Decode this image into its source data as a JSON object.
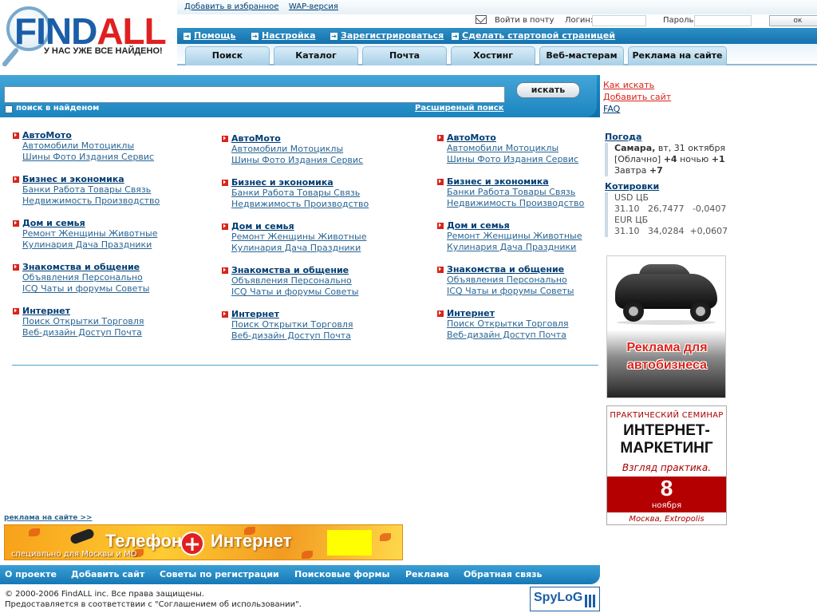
{
  "logo": {
    "name_part1": "FIND",
    "name_part2": "ALL",
    "slogan": "У НАС УЖЕ ВСЕ НАЙДЕНО!"
  },
  "topbar": {
    "favorites": "Добавить в избранное",
    "wap": "WAP-версия"
  },
  "login": {
    "mail_label": "Войти в почту",
    "login_label": "Логин:",
    "password_label": "Пароль:",
    "ok_label": "ок"
  },
  "links": {
    "help": "Помощь",
    "settings": "Настройка",
    "register": "Зарегистрироваться",
    "start_page_1": "Сделать",
    "start_page_2": "стартовой",
    "start_page_3": "страницей"
  },
  "tabs": [
    "Поиск",
    "Каталог",
    "Почта",
    "Хостинг",
    "Веб-мастерам",
    "Реклама на сайте"
  ],
  "search": {
    "button": "искать",
    "checkbox_label": "поиск в найденом",
    "advanced": "Расширеный поиск",
    "value": ""
  },
  "side_links": {
    "how": "Как искать",
    "add": "Добавить сайт",
    "faq": "FAQ"
  },
  "catalog": {
    "columns": [
      [
        {
          "title": "АвтоМото",
          "l1": "Автомобили Мотоциклы",
          "l2": "Шины Фото Издания Сервис"
        },
        {
          "title": "Бизнес и экономика",
          "l1": "Банки Работа Товары Связь",
          "l2": "Недвижимость Производство"
        },
        {
          "title": "Дом и семья",
          "l1": "Ремонт Женщины Животные",
          "l2": "Кулинария Дача Праздники"
        },
        {
          "title": "Знакомства и общение",
          "l1": "Объявления Персонально",
          "l2": "ICQ Чаты и форумы Советы"
        },
        {
          "title": "Интернет",
          "l1": "Поиск Открытки Торговля",
          "l2": "Веб-дизайн Доступ Почта"
        }
      ],
      [
        {
          "title": "АвтоМото",
          "l1": "Автомобили Мотоциклы",
          "l2": "Шины Фото Издания Сервис"
        },
        {
          "title": "Бизнес и экономика",
          "l1": "Банки Работа Товары Связь",
          "l2": "Недвижимость Производство"
        },
        {
          "title": "Дом и семья",
          "l1": "Ремонт Женщины Животные",
          "l2": "Кулинария Дача Праздники"
        },
        {
          "title": "Знакомства и общение",
          "l1": "Объявления Персонально",
          "l2": "ICQ Чаты и форумы Советы"
        },
        {
          "title": "Интернет",
          "l1": "Поиск Открытки Торговля",
          "l2": "Веб-дизайн Доступ Почта"
        }
      ],
      [
        {
          "title": "АвтоМото",
          "l1": "Автомобили Мотоциклы",
          "l2": "Шины Фото Издания Сервис"
        },
        {
          "title": "Бизнес и экономика",
          "l1": "Банки Работа Товары Связь",
          "l2": "Недвижимость Производство"
        },
        {
          "title": "Дом и семья",
          "l1": "Ремонт Женщины Животные",
          "l2": "Кулинария Дача Праздники"
        },
        {
          "title": "Знакомства и общение",
          "l1": "Объявления Персонально",
          "l2": "ICQ Чаты и форумы Советы"
        },
        {
          "title": "Интернет",
          "l1": "Поиск Открытки Торговля",
          "l2": "Веб-дизайн Доступ Почта"
        }
      ]
    ]
  },
  "weather": {
    "heading": "Погода",
    "city": "Самара,",
    "date": "вт, 31 октября",
    "condition": "[Облачно]",
    "temp_day": "+4",
    "night_label": "ночью",
    "temp_night": "+1",
    "tomorrow_label": "Завтра",
    "temp_tomorrow": "+7"
  },
  "rates": {
    "heading": "Котировки",
    "usd_label": "USD ЦБ",
    "usd_row": "31.10   26,7477   -0,0407",
    "eur_label": "EUR ЦБ",
    "eur_row": "31.10   34,0284  +0,0607"
  },
  "ad_car": {
    "text": "Реклама для автобизнеса"
  },
  "ad_seminar": {
    "line1": "ПРАКТИЧЕСКИЙ СЕМИНАР",
    "line2a": "ИНТЕРНЕТ-",
    "line2b": "МАРКЕТИНГ",
    "line3": "Взгляд практика.",
    "day": "8",
    "month": "ноября",
    "location": "Москва, Extropolis"
  },
  "ad_label": "реклама на сайте >>",
  "banner": {
    "part1": "Телефон",
    "plus": "+",
    "part2": "Интернет",
    "subtitle": "специально для Москвы и МО"
  },
  "footer": {
    "nav": [
      "О проекте",
      "Добавить сайт",
      "Советы по регистрации",
      "Поисковые формы",
      "Реклама",
      "Обратная связь"
    ],
    "copyright": "© 2000-2006 FindALL inc. Все права защищены.",
    "terms": "Предоставляется в соответствии с \"Соглашением об использовании\".",
    "counter": "SpyLoG"
  },
  "colors": {
    "brand_blue": "#1b5ea8",
    "brand_red": "#e02020",
    "bar_blue": "#1e8cc8",
    "link": "#003d73"
  }
}
